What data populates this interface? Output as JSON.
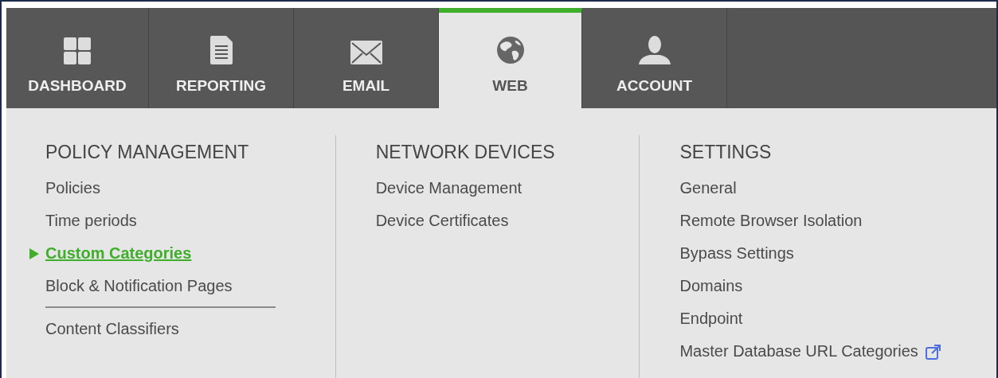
{
  "tabs": [
    {
      "label": "DASHBOARD",
      "kind": "grid",
      "selected": false
    },
    {
      "label": "REPORTING",
      "kind": "document",
      "selected": false
    },
    {
      "label": "EMAIL",
      "kind": "envelope",
      "selected": false
    },
    {
      "label": "WEB",
      "kind": "globe",
      "selected": true
    },
    {
      "label": "ACCOUNT",
      "kind": "person",
      "selected": false
    }
  ],
  "menu_columns": [
    {
      "heading": "POLICY MANAGEMENT",
      "items": [
        {
          "label": "Policies",
          "selected": false
        },
        {
          "label": "Time periods",
          "selected": false
        },
        {
          "label": "Custom Categories",
          "selected": true
        },
        {
          "label": "Block & Notification Pages",
          "selected": false
        },
        {
          "label": "Content Classifiers",
          "selected": false,
          "divider_before": true
        }
      ]
    },
    {
      "heading": "NETWORK DEVICES",
      "items": [
        {
          "label": "Device Management",
          "selected": false
        },
        {
          "label": "Device Certificates",
          "selected": false
        }
      ]
    },
    {
      "heading": "SETTINGS",
      "items": [
        {
          "label": "General",
          "selected": false
        },
        {
          "label": "Remote Browser Isolation",
          "selected": false
        },
        {
          "label": "Bypass Settings",
          "selected": false
        },
        {
          "label": "Domains",
          "selected": false
        },
        {
          "label": "Endpoint",
          "selected": false
        },
        {
          "label": "Master Database URL Categories",
          "selected": false,
          "external": true
        }
      ]
    }
  ]
}
